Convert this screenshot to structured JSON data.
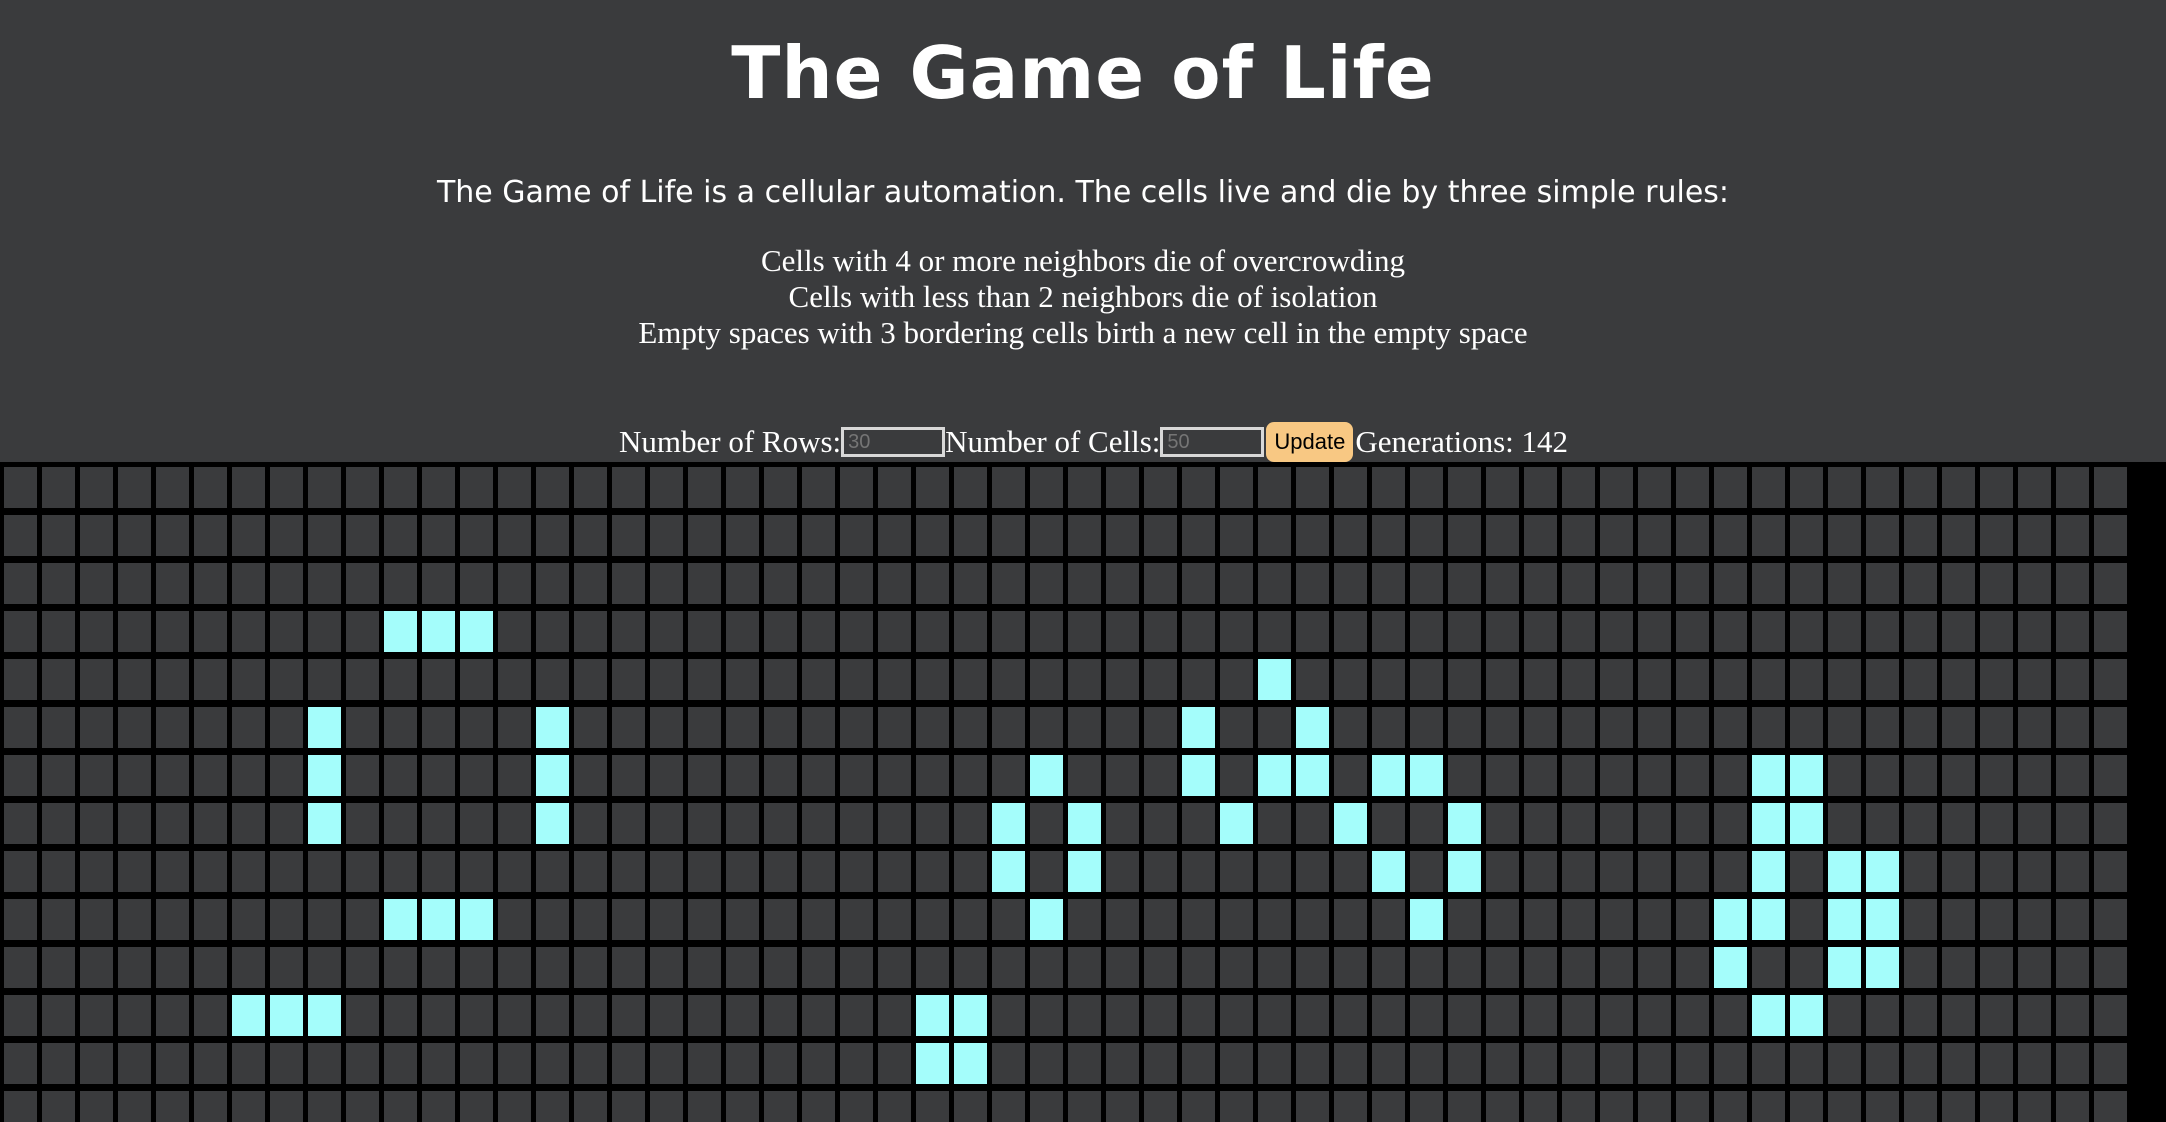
{
  "title": "The Game of Life",
  "intro": "The Game of Life is a cellular automation. The cells live and die by three simple rules:",
  "rules": [
    "Cells with 4 or more neighbors die of overcrowding",
    "Cells with less than 2 neighbors die of isolation",
    "Empty spaces with 3 bordering cells birth a new cell in the empty space"
  ],
  "controls": {
    "rows_label": "Number of Rows:",
    "rows_placeholder": "30",
    "cells_label": "Number of Cells:",
    "cells_placeholder": "50",
    "update_label": "Update",
    "generations_label": "Generations: 142"
  },
  "colors": {
    "background": "#3a3b3d",
    "grid_lines": "#000000",
    "dead_cell": "#3a3b3d",
    "alive_cell": "#a4fdfb",
    "update_button": "#f8c883"
  },
  "board": {
    "visible_rows": 14,
    "visible_cols": 57,
    "alive": [
      [
        3,
        11
      ],
      [
        3,
        12
      ],
      [
        3,
        13
      ],
      [
        4,
        34
      ],
      [
        5,
        9
      ],
      [
        5,
        15
      ],
      [
        5,
        32
      ],
      [
        5,
        35
      ],
      [
        6,
        9
      ],
      [
        6,
        15
      ],
      [
        6,
        28
      ],
      [
        6,
        32
      ],
      [
        6,
        34
      ],
      [
        6,
        35
      ],
      [
        6,
        37
      ],
      [
        6,
        38
      ],
      [
        6,
        47
      ],
      [
        6,
        48
      ],
      [
        7,
        9
      ],
      [
        7,
        15
      ],
      [
        7,
        27
      ],
      [
        7,
        29
      ],
      [
        7,
        33
      ],
      [
        7,
        36
      ],
      [
        7,
        39
      ],
      [
        7,
        47
      ],
      [
        7,
        48
      ],
      [
        8,
        27
      ],
      [
        8,
        29
      ],
      [
        8,
        37
      ],
      [
        8,
        39
      ],
      [
        8,
        47
      ],
      [
        8,
        49
      ],
      [
        8,
        50
      ],
      [
        9,
        11
      ],
      [
        9,
        12
      ],
      [
        9,
        13
      ],
      [
        9,
        28
      ],
      [
        9,
        38
      ],
      [
        9,
        46
      ],
      [
        9,
        47
      ],
      [
        9,
        49
      ],
      [
        9,
        50
      ],
      [
        10,
        46
      ],
      [
        10,
        49
      ],
      [
        10,
        50
      ],
      [
        11,
        7
      ],
      [
        11,
        8
      ],
      [
        11,
        9
      ],
      [
        11,
        25
      ],
      [
        11,
        26
      ],
      [
        11,
        47
      ],
      [
        11,
        48
      ],
      [
        12,
        25
      ],
      [
        12,
        26
      ]
    ]
  }
}
